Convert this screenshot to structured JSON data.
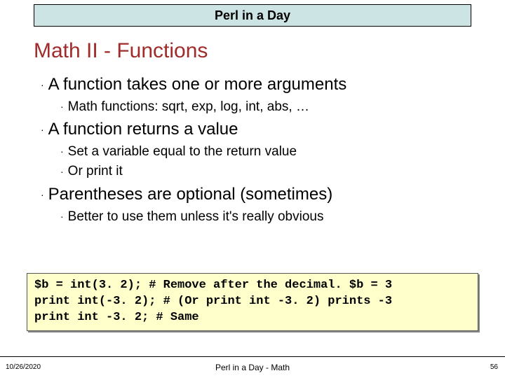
{
  "header": {
    "title": "Perl in a Day"
  },
  "slide": {
    "title": "Math II - Functions"
  },
  "bullets": {
    "b1a": "A function takes one or more arguments",
    "b2a": "Math functions: sqrt, exp, log, int, abs, …",
    "b1b": "A function returns a value",
    "b2b": "Set a variable equal to the return value",
    "b2c": "Or print it",
    "b1c": "Parentheses are optional (sometimes)",
    "b2d": "Better to use them unless it's really obvious"
  },
  "code": "$b = int(3. 2); # Remove after the decimal. $b = 3\nprint int(-3. 2); # (Or print int -3. 2) prints -3\nprint int -3. 2; # Same",
  "footer": {
    "date": "10/26/2020",
    "center": "Perl in a Day - Math",
    "page": "56"
  }
}
